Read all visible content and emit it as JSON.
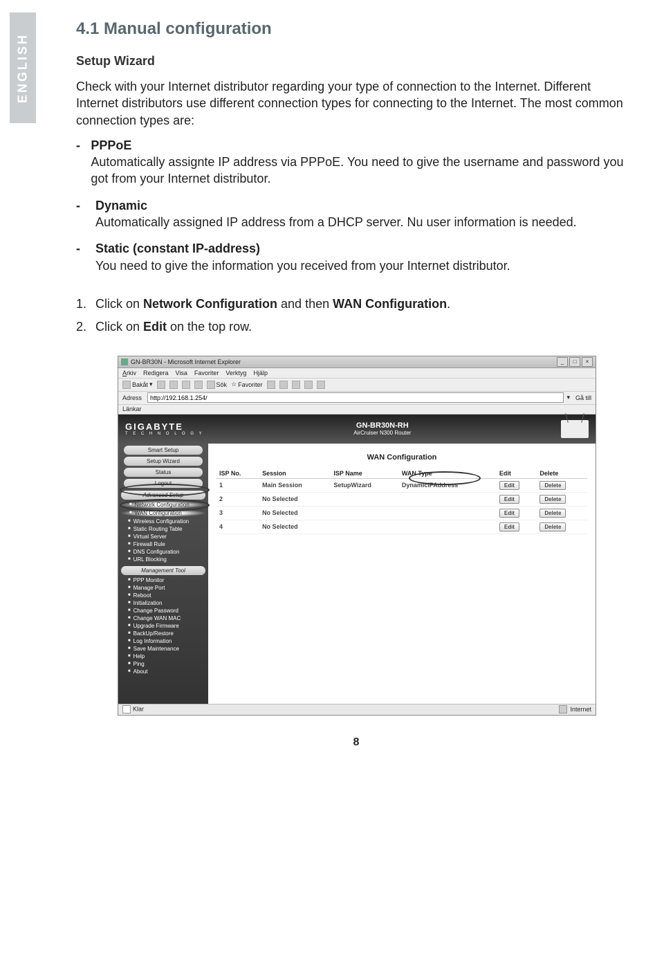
{
  "sideTab": "ENGLISH",
  "heading": "4.1 Manual configuration",
  "subheading": "Setup Wizard",
  "intro": "Check with your Internet distributor regarding your type of connection to the Internet. Different Internet distributors use different connection types for connecting to the Internet. The most common connection types are:",
  "types": [
    {
      "label": "PPPoE",
      "text": "Automatically assignte IP address via PPPoE. You need to give the username and password you got from your Internet distributor."
    },
    {
      "label": "Dynamic",
      "text": "Automatically assigned IP address from a DHCP server.  Nu user information is needed."
    },
    {
      "label": "Static (constant IP-address)",
      "text": "You need to give the information you received from your Internet distributor."
    }
  ],
  "steps": [
    {
      "num": "1.",
      "pre": "Click on ",
      "b1": "Network Configuration",
      "mid": " and then ",
      "b2": "WAN Configuration",
      "post": "."
    },
    {
      "num": "2.",
      "pre": "Click on ",
      "b1": "Edit",
      "mid": " on the top row.",
      "b2": "",
      "post": ""
    }
  ],
  "browser": {
    "title": "GN-BR30N - Microsoft Internet Explorer",
    "menus": [
      "Arkiv",
      "Redigera",
      "Visa",
      "Favoriter",
      "Verktyg",
      "Hjälp"
    ],
    "back": "Bakåt",
    "search": "Sök",
    "favorites": "Favoriter",
    "addressLabel": "Adress",
    "url": "http://192.168.1.254/",
    "go": "Gå till",
    "links": "Länkar",
    "statusLeft": "Klar",
    "statusRight": "Internet"
  },
  "router": {
    "brand": "GIGABYTE",
    "brandSub": "T E C H N O L O G Y",
    "model": "GN-BR30N-RH",
    "modelSub": "AirCruiser N300 Router",
    "sideButtons": [
      "Smart Setup",
      "Setup Wizard",
      "Status",
      "Logout"
    ],
    "advanced": "Advanced Setup",
    "advItems1": [
      "Network Configuration",
      "WAN Configuration",
      "Wireless Configuration",
      "Static Routing Table",
      "Virtual Server",
      "Firewall Rule",
      "DNS Configuration",
      "URL Blocking"
    ],
    "mgmt": "Management Tool",
    "advItems2": [
      "PPP Monitor",
      "Manage Port",
      "Reboot",
      "Initialization",
      "Change Password",
      "Change WAN MAC",
      "Upgrade Firmware",
      "BackUp/Restore",
      "Log Information",
      "Save Maintenance",
      "Help",
      "Ping",
      "About"
    ],
    "panelTitle": "WAN Configuration",
    "tableHeaders": [
      "ISP No.",
      "Session",
      "ISP Name",
      "WAN Type",
      "Edit",
      "Delete"
    ],
    "rows": [
      {
        "no": "1",
        "session": "Main Session",
        "isp": "SetupWizard",
        "wan": "DynamicIPAddress"
      },
      {
        "no": "2",
        "session": "No Selected",
        "isp": "",
        "wan": ""
      },
      {
        "no": "3",
        "session": "No Selected",
        "isp": "",
        "wan": ""
      },
      {
        "no": "4",
        "session": "No Selected",
        "isp": "",
        "wan": ""
      }
    ],
    "editLabel": "Edit",
    "deleteLabel": "Delete"
  },
  "pageNum": "8"
}
